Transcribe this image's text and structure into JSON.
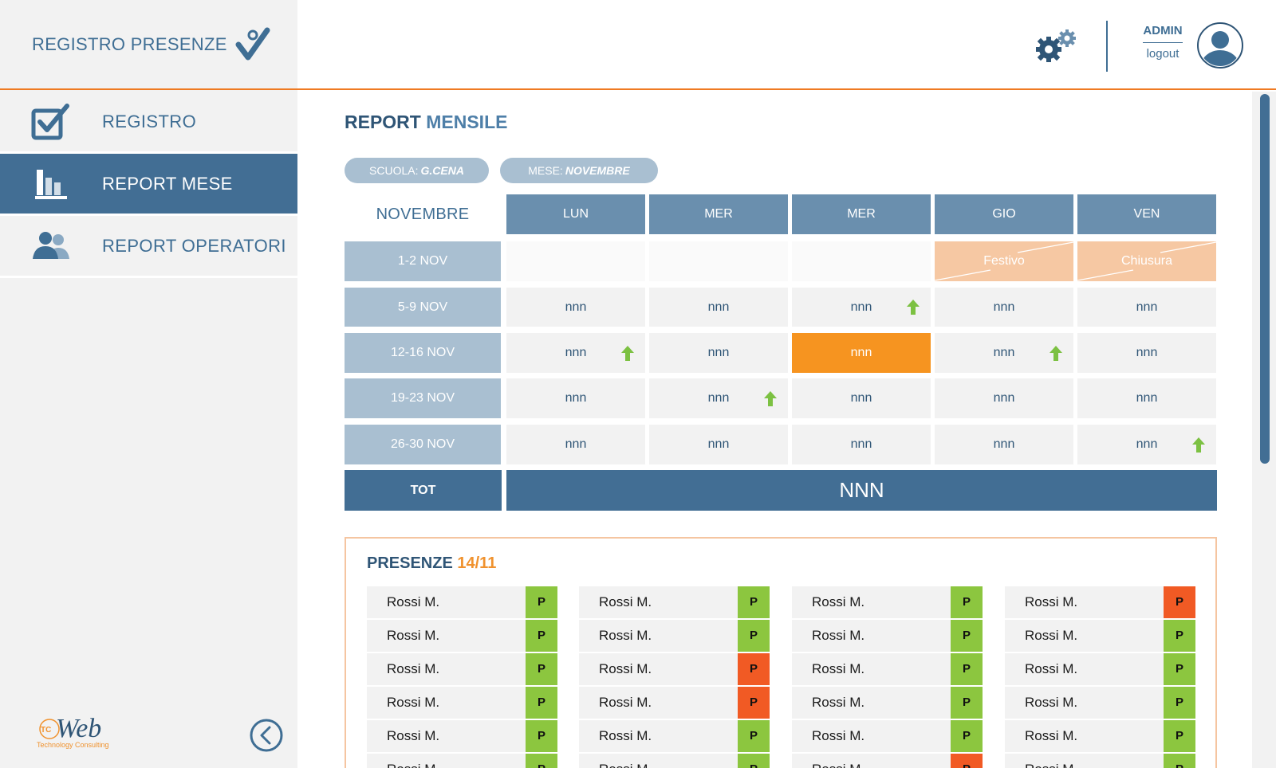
{
  "app": {
    "title": "REGISTRO PRESENZE"
  },
  "nav": [
    {
      "label": "REGISTRO",
      "icon": "checkbox-icon",
      "active": false
    },
    {
      "label": "REPORT MESE",
      "icon": "bar-chart-icon",
      "active": true
    },
    {
      "label": "REPORT OPERATORI",
      "icon": "users-icon",
      "active": false
    }
  ],
  "header": {
    "user": "ADMIN",
    "logout": "logout",
    "settings_icon": "gears-icon",
    "avatar_icon": "user-avatar-icon"
  },
  "footer": {
    "logo_text": "Web",
    "logo_badge": "TC",
    "logo_sub": "Technology Consulting",
    "collapse_icon": "chevron-left-circle-icon"
  },
  "page": {
    "title_strong": "REPORT",
    "title_rest": "MENSILE",
    "filters": {
      "school_label": "SCUOLA:",
      "school_value": "G.CENA",
      "month_label": "MESE:",
      "month_value": "NOVEMBRE"
    }
  },
  "calendar": {
    "month": "NOVEMBRE",
    "days": [
      "LUN",
      "MER",
      "MER",
      "GIO",
      "VEN"
    ],
    "weeks": [
      {
        "label": "1-2 NOV",
        "cells": [
          {
            "value": "",
            "type": "empty"
          },
          {
            "value": "",
            "type": "empty"
          },
          {
            "value": "",
            "type": "empty"
          },
          {
            "value": "Festivo",
            "type": "special"
          },
          {
            "value": "Chiusura",
            "type": "special"
          }
        ]
      },
      {
        "label": "5-9 NOV",
        "cells": [
          {
            "value": "nnn"
          },
          {
            "value": "nnn"
          },
          {
            "value": "nnn",
            "up": true
          },
          {
            "value": "nnn"
          },
          {
            "value": "nnn"
          }
        ]
      },
      {
        "label": "12-16 NOV",
        "cells": [
          {
            "value": "nnn",
            "up": true
          },
          {
            "value": "nnn"
          },
          {
            "value": "nnn",
            "type": "highlight"
          },
          {
            "value": "nnn",
            "up": true
          },
          {
            "value": "nnn"
          }
        ]
      },
      {
        "label": "19-23 NOV",
        "cells": [
          {
            "value": "nnn"
          },
          {
            "value": "nnn",
            "up": true
          },
          {
            "value": "nnn"
          },
          {
            "value": "nnn"
          },
          {
            "value": "nnn"
          }
        ]
      },
      {
        "label": "26-30 NOV",
        "cells": [
          {
            "value": "nnn"
          },
          {
            "value": "nnn"
          },
          {
            "value": "nnn"
          },
          {
            "value": "nnn"
          },
          {
            "value": "nnn",
            "up": true
          }
        ]
      }
    ],
    "total_label": "TOT",
    "total_value": "NNN"
  },
  "presenze": {
    "title": "PRESENZE",
    "date": "14/11",
    "columns": [
      [
        {
          "name": "Rossi M.",
          "status": "P",
          "color": "green"
        },
        {
          "name": "Rossi M.",
          "status": "P",
          "color": "green"
        },
        {
          "name": "Rossi M.",
          "status": "P",
          "color": "green"
        },
        {
          "name": "Rossi M.",
          "status": "P",
          "color": "green"
        },
        {
          "name": "Rossi M.",
          "status": "P",
          "color": "green"
        },
        {
          "name": "Rossi M.",
          "status": "P",
          "color": "green"
        }
      ],
      [
        {
          "name": "Rossi M.",
          "status": "P",
          "color": "green"
        },
        {
          "name": "Rossi M.",
          "status": "P",
          "color": "green"
        },
        {
          "name": "Rossi M.",
          "status": "P",
          "color": "red"
        },
        {
          "name": "Rossi M.",
          "status": "P",
          "color": "red"
        },
        {
          "name": "Rossi M.",
          "status": "P",
          "color": "green"
        },
        {
          "name": "Rossi M.",
          "status": "P",
          "color": "green"
        }
      ],
      [
        {
          "name": "Rossi M.",
          "status": "P",
          "color": "green"
        },
        {
          "name": "Rossi M.",
          "status": "P",
          "color": "green"
        },
        {
          "name": "Rossi M.",
          "status": "P",
          "color": "green"
        },
        {
          "name": "Rossi M.",
          "status": "P",
          "color": "green"
        },
        {
          "name": "Rossi M.",
          "status": "P",
          "color": "green"
        },
        {
          "name": "Rossi M.",
          "status": "P",
          "color": "red"
        }
      ],
      [
        {
          "name": "Rossi M.",
          "status": "P",
          "color": "red"
        },
        {
          "name": "Rossi M.",
          "status": "P",
          "color": "green"
        },
        {
          "name": "Rossi M.",
          "status": "P",
          "color": "green"
        },
        {
          "name": "Rossi M.",
          "status": "P",
          "color": "green"
        },
        {
          "name": "Rossi M.",
          "status": "P",
          "color": "green"
        },
        {
          "name": "Rossi M.",
          "status": "P",
          "color": "green"
        }
      ]
    ]
  },
  "colors": {
    "primary": "#426e94",
    "header_day": "#6a8fae",
    "week_label": "#a9bfd1",
    "accent_orange": "#ef7a22",
    "highlight": "#f69420",
    "special": "#f6c8a3",
    "status_green": "#8cc63f",
    "status_red": "#f15a24",
    "arrow_green": "#7cc142"
  }
}
